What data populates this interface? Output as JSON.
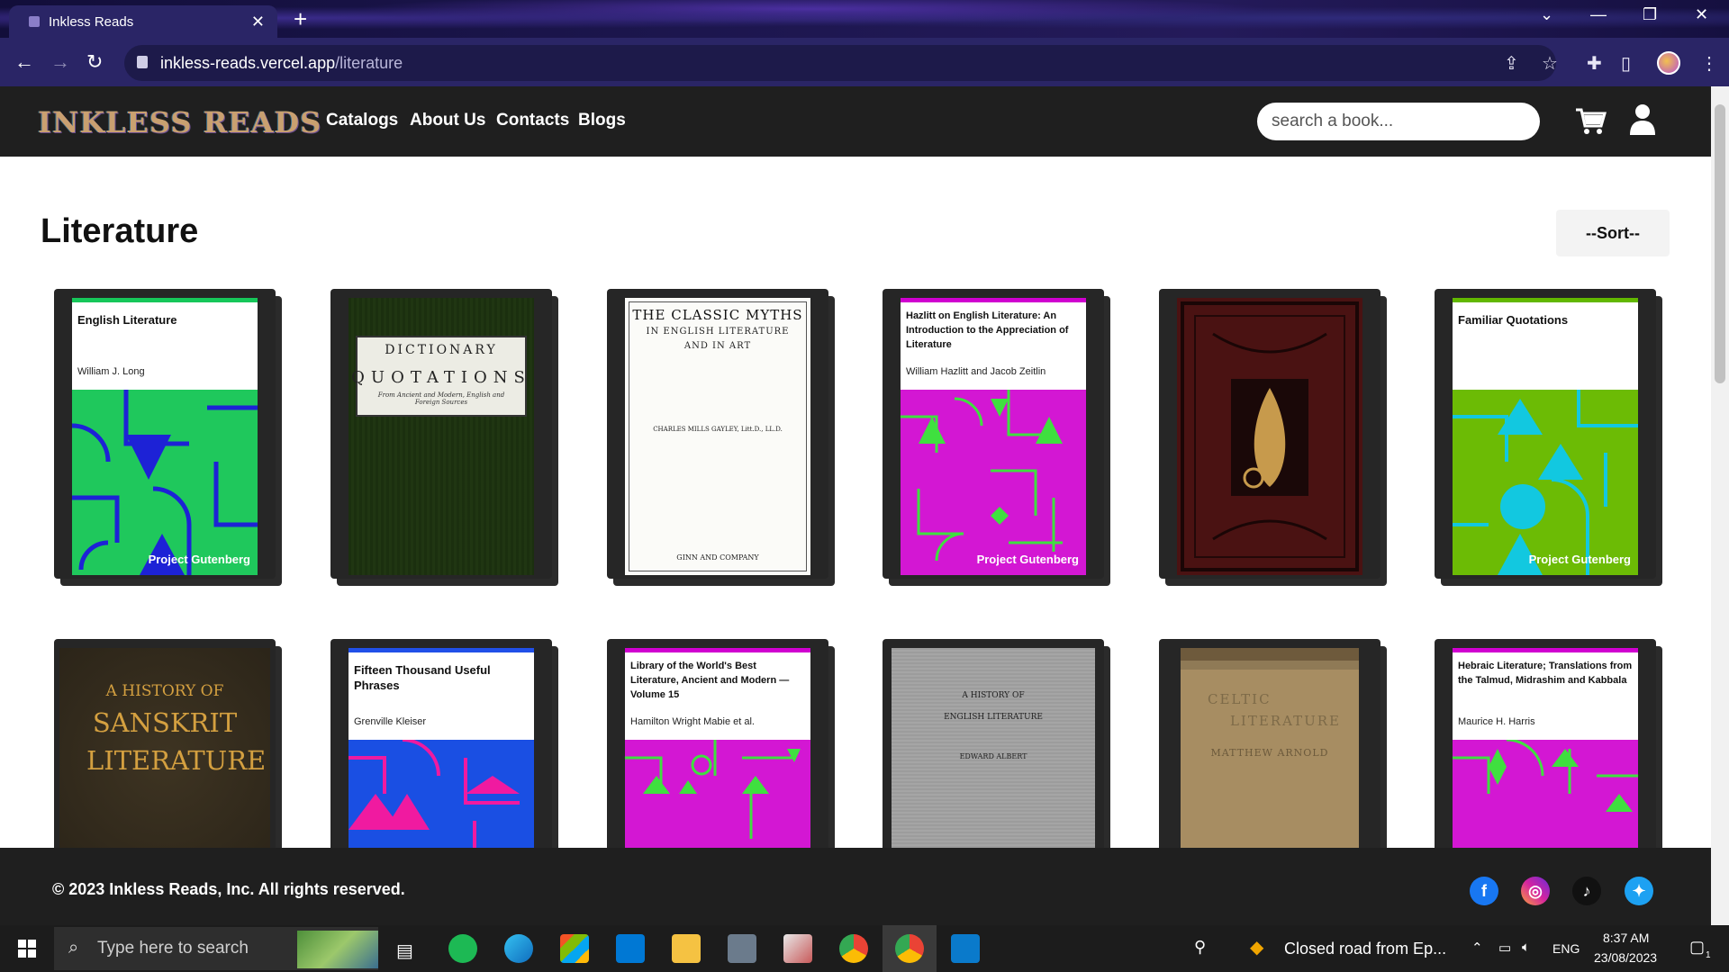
{
  "browser": {
    "tab_title": "Inkless Reads",
    "tab_close": "✕",
    "new_tab": "+",
    "url_host": "inkless-reads.vercel.app",
    "url_path": "/literature",
    "win_min": "—",
    "win_restore": "❐",
    "win_close": "✕",
    "chevron": "⌄"
  },
  "site": {
    "logo": "INKLESS READS",
    "nav": [
      "Catalogs",
      "About Us",
      "Contacts",
      "Blogs"
    ],
    "search_placeholder": "search a book..."
  },
  "main": {
    "title": "Literature",
    "sort_label": "--Sort--",
    "books_row1": [
      {
        "title": "English Literature",
        "author": "William J. Long",
        "brand": "Project Gutenberg",
        "style": "pg",
        "bar": "#16c75a",
        "bg": "#1fc85c",
        "fg": "#1d22d6"
      },
      {
        "title": "DICTIONARY",
        "subtitle": "QUOTATIONS",
        "note": "From Ancient and Modern, English and Foreign Sources",
        "style": "green-cloth"
      },
      {
        "title": "THE CLASSIC MYTHS",
        "subtitle": "IN ENGLISH LITERATURE AND IN ART",
        "author": "CHARLES MILLS GAYLEY, Litt.D., LL.D.",
        "publisher": "GINN AND COMPANY",
        "style": "white-page"
      },
      {
        "title": "Hazlitt on English Literature: An Introduction to the Appreciation of Literature",
        "author": "William Hazlitt and Jacob Zeitlin",
        "brand": "Project Gutenberg",
        "style": "pg",
        "bar": "#d000d0",
        "bg": "#d317d3",
        "fg": "#3fe03f"
      },
      {
        "style": "red-cloth"
      },
      {
        "title": "Familiar Quotations",
        "author": "",
        "brand": "Project Gutenberg",
        "style": "pg",
        "bar": "#62b800",
        "bg": "#6cbb05",
        "fg": "#12c8e0"
      }
    ],
    "books_row2": [
      {
        "title": "A HISTORY OF",
        "subtitle": "SANSKRIT LITERATURE",
        "style": "dark-cloth"
      },
      {
        "title": "Fifteen Thousand Useful Phrases",
        "author": "Grenville Kleiser",
        "style": "pg",
        "bar": "#2150e8",
        "bg": "#1a4fe3",
        "fg": "#f01aa0"
      },
      {
        "title": "Library of the World's Best Literature, Ancient and Modern — Volume 15",
        "author": "Hamilton Wright Mabie et al.",
        "style": "pg",
        "bar": "#d000d0",
        "bg": "#d317d3",
        "fg": "#3fe03f"
      },
      {
        "title": "A HISTORY OF",
        "subtitle": "ENGLISH LITERATURE",
        "author": "EDWARD ALBERT",
        "style": "grey-cloth"
      },
      {
        "title": "CELTIC",
        "subtitle": "LITERATURE",
        "author": "MATTHEW ARNOLD",
        "style": "tan-cloth"
      },
      {
        "title": "Hebraic Literature; Translations from the Talmud, Midrashim and Kabbala",
        "author": "Maurice H. Harris",
        "style": "pg",
        "bar": "#d000d0",
        "bg": "#d317d3",
        "fg": "#3fe03f"
      }
    ]
  },
  "footer": {
    "copyright": "© 2023 Inkless Reads, Inc. All rights reserved.",
    "social": [
      {
        "icon": "facebook-icon",
        "glyph": "f",
        "color": "#1877f2"
      },
      {
        "icon": "instagram-icon",
        "glyph": "◎",
        "color": "#d6249f"
      },
      {
        "icon": "tiktok-icon",
        "glyph": "♪",
        "color": "#111111"
      },
      {
        "icon": "twitter-icon",
        "glyph": "✦",
        "color": "#1da1f2"
      }
    ]
  },
  "taskbar": {
    "search_placeholder": "Type here to search",
    "news": "Closed road from Ep...",
    "lang": "ENG",
    "time": "8:37 AM",
    "date": "23/08/2023",
    "notif_count": "1"
  }
}
